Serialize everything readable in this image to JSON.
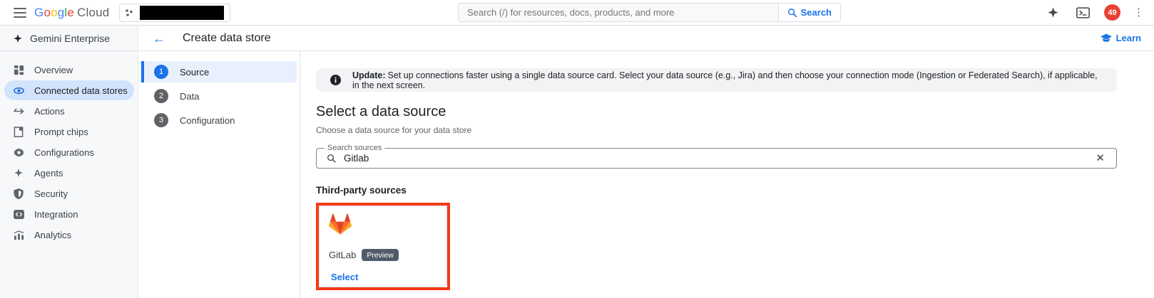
{
  "colors": {
    "accent": "#1a73e8",
    "selection_bg": "#d2e3fc",
    "step_active_bg": "#e8f0fe",
    "banner_bg": "#f1f3f4",
    "annotation": "#f43b17",
    "badge_bg": "#515c6b",
    "notification": "#e94235"
  },
  "topbar": {
    "logo": {
      "letters": [
        "G",
        "o",
        "o",
        "g",
        "l",
        "e"
      ],
      "cloud": "Cloud"
    },
    "search": {
      "placeholder": "Search (/) for resources, docs, products, and more",
      "button_label": "Search"
    },
    "notification_count": "49"
  },
  "header": {
    "product": "Gemini Enterprise",
    "page_title": "Create data store",
    "learn_label": "Learn"
  },
  "sidebar": {
    "items": [
      {
        "label": "Overview"
      },
      {
        "label": "Connected data stores",
        "selected": true
      },
      {
        "label": "Actions"
      },
      {
        "label": "Prompt chips"
      },
      {
        "label": "Configurations"
      },
      {
        "label": "Agents"
      },
      {
        "label": "Security"
      },
      {
        "label": "Integration"
      },
      {
        "label": "Analytics"
      }
    ]
  },
  "steps": [
    {
      "num": "1",
      "label": "Source",
      "active": true
    },
    {
      "num": "2",
      "label": "Data",
      "active": false
    },
    {
      "num": "3",
      "label": "Configuration",
      "active": false
    }
  ],
  "main": {
    "banner": {
      "prefix": "Update:",
      "text": "Set up connections faster using a single data source card. Select your data source (e.g., Jira) and then choose your connection mode (Ingestion or Federated Search), if applicable, in the next screen."
    },
    "heading": "Select a data source",
    "subheading": "Choose a data source for your data store",
    "search_field": {
      "label": "Search sources",
      "value": "Gitlab"
    },
    "section_title": "Third-party sources",
    "card": {
      "name": "GitLab",
      "badge": "Preview",
      "action": "Select"
    }
  }
}
